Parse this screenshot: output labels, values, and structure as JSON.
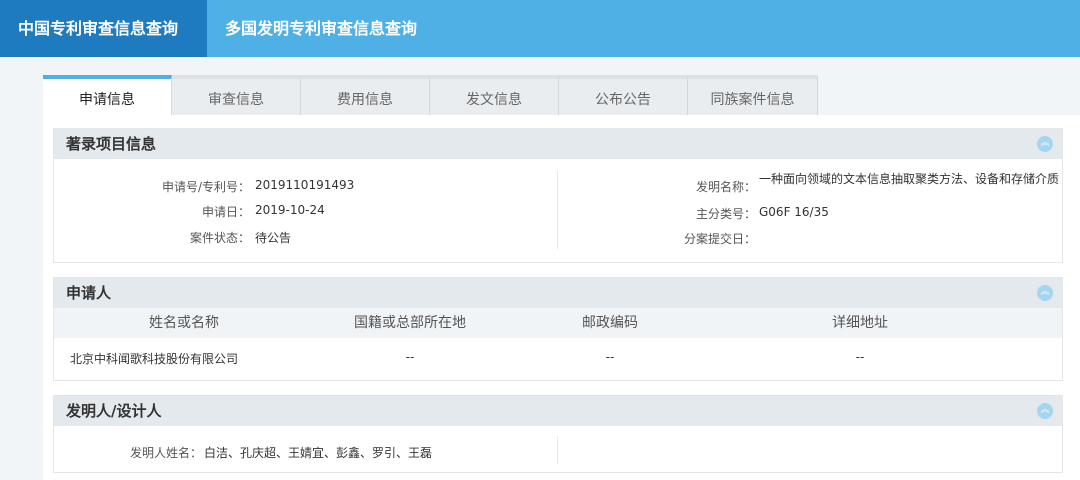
{
  "topnav": {
    "items": [
      {
        "label": "中国专利审查信息查询"
      },
      {
        "label": "多国发明专利审查信息查询"
      }
    ]
  },
  "tabs": [
    {
      "label": "申请信息"
    },
    {
      "label": "审查信息"
    },
    {
      "label": "费用信息"
    },
    {
      "label": "发文信息"
    },
    {
      "label": "公布公告"
    },
    {
      "label": "同族案件信息"
    }
  ],
  "biblio": {
    "title": "著录项目信息",
    "left": [
      {
        "label": "申请号/专利号：",
        "value": "2019110191493"
      },
      {
        "label": "申请日：",
        "value": "2019-10-24"
      },
      {
        "label": "案件状态：",
        "value": "待公告"
      }
    ],
    "right": [
      {
        "label": "发明名称：",
        "value": "一种面向领域的文本信息抽取聚类方法、设备和存储介质"
      },
      {
        "label": "主分类号：",
        "value": "G06F 16/35"
      },
      {
        "label": "分案提交日：",
        "value": ""
      }
    ]
  },
  "applicant": {
    "title": "申请人",
    "columns": [
      "姓名或名称",
      "国籍或总部所在地",
      "邮政编码",
      "详细地址"
    ],
    "rows": [
      [
        "北京中科闻歌科技股份有限公司",
        "--",
        "--",
        "--"
      ]
    ]
  },
  "inventor": {
    "title": "发明人/设计人",
    "label": "发明人姓名：",
    "value": "白洁、孔庆超、王婧宜、彭鑫、罗引、王磊"
  },
  "icons": {
    "collapse": "chevron-up-icon"
  }
}
